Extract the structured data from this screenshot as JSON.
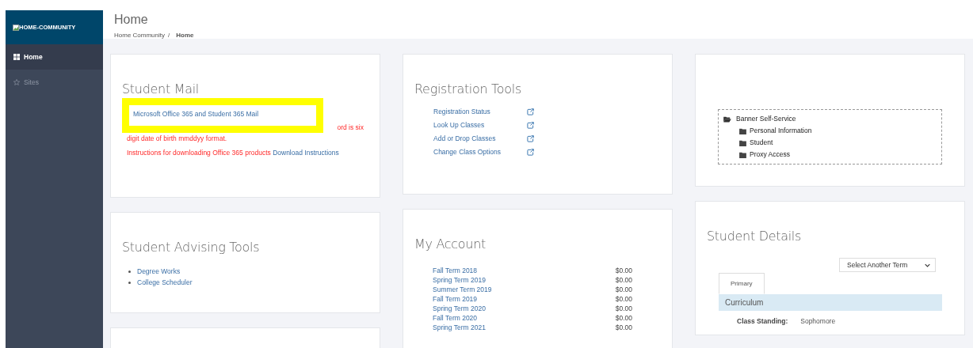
{
  "sidebar": {
    "logo": "HOME-COMMUNITY",
    "items": [
      {
        "label": "Home",
        "kind": "grid",
        "selected": true
      },
      {
        "label": "Sites",
        "kind": "star",
        "selected": false
      }
    ]
  },
  "header": {
    "title": "Home",
    "breadcrumb": [
      {
        "label": "Home Community",
        "current": false
      },
      {
        "label": "Home",
        "current": true
      }
    ],
    "separator": "/"
  },
  "student_mail": {
    "title": "Student Mail",
    "highlighted_link": "Microsoft Office 365 and Student 365 Mail",
    "notice_tail": "ord is six",
    "notice_line2": "digit date of birth mmddyy format.",
    "instructions": "Instructions for downloading Office 365 products",
    "instructions_link": "Download Instructions"
  },
  "registration_tools": {
    "title": "Registration Tools",
    "links": [
      "Registration Status",
      "Look Up Classes",
      "Add or Drop Classes",
      "Change Class Options"
    ]
  },
  "banner_tree": {
    "label": "Banner Self-Service",
    "expanded": true,
    "children": [
      {
        "label": "Personal Information"
      },
      {
        "label": "Student"
      },
      {
        "label": "Proxy Access"
      }
    ]
  },
  "student_advising_tools": {
    "title": "Student Advising Tools",
    "links": [
      "Degree Works",
      "College Scheduler"
    ]
  },
  "my_account": {
    "title": "My Account",
    "rows": [
      {
        "term": "Fall Term 2018",
        "amount": "$0.00"
      },
      {
        "term": "Spring Term 2019",
        "amount": "$0.00"
      },
      {
        "term": "Summer Term 2019",
        "amount": "$0.00"
      },
      {
        "term": "Fall Term 2019",
        "amount": "$0.00"
      },
      {
        "term": "Spring Term 2020",
        "amount": "$0.00"
      },
      {
        "term": "Fall Term 2020",
        "amount": "$0.00"
      },
      {
        "term": "Spring Term 2021",
        "amount": "$0.00"
      }
    ]
  },
  "student_details": {
    "title": "Student Details",
    "term_select": "Select Another Term",
    "tabs": [
      {
        "label": "Primary",
        "selected": true
      }
    ],
    "section": "Curriculum",
    "fields": [
      {
        "label": "Class Standing:",
        "value": "Sophomore"
      }
    ]
  }
}
